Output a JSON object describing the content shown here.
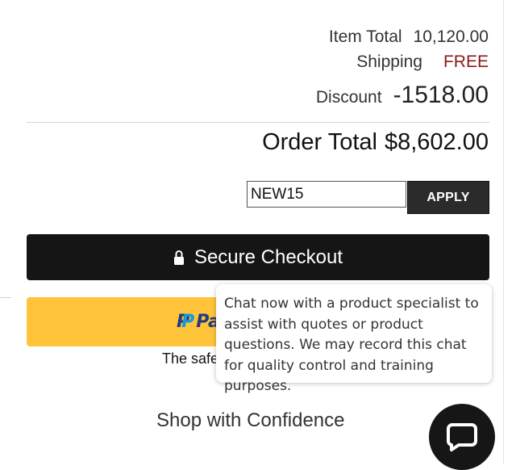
{
  "summary": {
    "item_total_label": "Item Total",
    "item_total_value": "10,120.00",
    "shipping_label": "Shipping",
    "shipping_value": "FREE",
    "discount_label": "Discount",
    "discount_value": "-1518.00"
  },
  "order_total": {
    "label": "Order Total",
    "value": "$8,602.00"
  },
  "promo": {
    "code_value": "NEW15",
    "apply_label": "APPLY"
  },
  "checkout": {
    "label": "Secure Checkout",
    "icon": "lock-icon"
  },
  "paypal": {
    "brand_partial": "Pa",
    "icon": "paypal-logo"
  },
  "safe_text_partial": "The safe",
  "confidence_text": "Shop with Confidence",
  "chat": {
    "tooltip_text": "Chat now with a product specialist to assist with quotes or product questions. We may record this chat for quality control and training purposes.",
    "icon": "chat-bubble-icon"
  },
  "colors": {
    "shipping_free": "#8b1a1a",
    "checkout_bg": "#151515",
    "paypal_bg": "#ffc439",
    "paypal_dark": "#253b80",
    "paypal_light": "#179bd7",
    "apply_bg": "#2b2b2b"
  }
}
